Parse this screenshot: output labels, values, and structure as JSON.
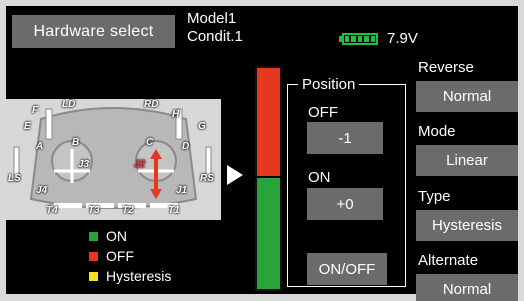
{
  "header": {
    "title": "Hardware select",
    "model": "Model1",
    "condition": "Condit.1",
    "battery_voltage": "7.9V"
  },
  "illustration": {
    "labels": [
      "LD",
      "RD",
      "E",
      "H",
      "F",
      "G",
      "A",
      "B",
      "C",
      "D",
      "LS",
      "RS",
      "J1",
      "J2",
      "J3",
      "J4",
      "T1",
      "T2",
      "T3",
      "T4"
    ],
    "active_label": "J2"
  },
  "colors": {
    "on": "#27a43a",
    "off": "#e8371f",
    "hysteresis": "#f5e01a",
    "button_bg": "#6b6b6b"
  },
  "position_panel": {
    "title": "Position",
    "off_label": "OFF",
    "off_value": "-1",
    "on_label": "ON",
    "on_value": "+0",
    "toggle_button": "ON/OFF"
  },
  "level_bar": {
    "off_fraction": 0.49,
    "on_fraction": 0.51
  },
  "settings": {
    "reverse_label": "Reverse",
    "reverse_value": "Normal",
    "mode_label": "Mode",
    "mode_value": "Linear",
    "type_label": "Type",
    "type_value": "Hysteresis",
    "alternate_label": "Alternate",
    "alternate_value": "Normal"
  },
  "legend": [
    {
      "label": "ON",
      "color": "#27a43a"
    },
    {
      "label": "OFF",
      "color": "#e8371f"
    },
    {
      "label": "Hysteresis",
      "color": "#f5e01a"
    }
  ]
}
